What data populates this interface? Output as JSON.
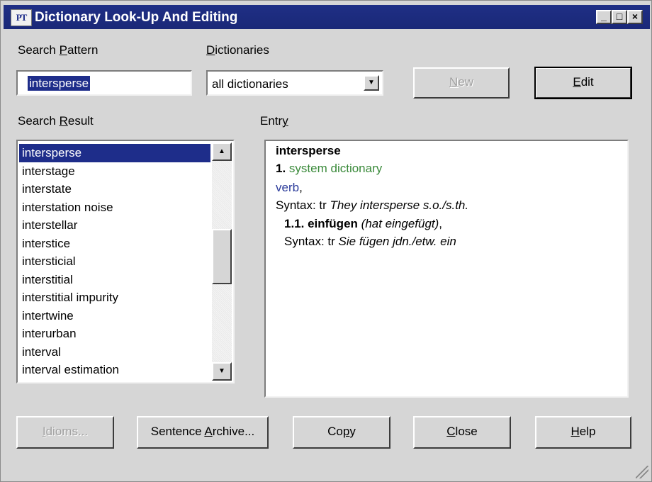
{
  "window": {
    "title": "Dictionary Look-Up And Editing",
    "icon_text": "PT",
    "controls": {
      "minimize": "_",
      "maximize": "□",
      "close": "×"
    }
  },
  "search": {
    "label_pre": "Search ",
    "label_key": "P",
    "label_post": "attern",
    "value": "intersperse"
  },
  "dictionaries": {
    "label_key": "D",
    "label_post": "ictionaries",
    "selected": "all dictionaries"
  },
  "buttons": {
    "new": {
      "key": "N",
      "rest": "ew"
    },
    "edit": {
      "key": "E",
      "rest": "dit"
    },
    "idioms": {
      "key": "I",
      "rest": "dioms..."
    },
    "sentence_archive": {
      "pre": "Sentence ",
      "key": "A",
      "rest": "rchive..."
    },
    "copy": {
      "pre": "Co",
      "key": "p",
      "rest": "y"
    },
    "close": {
      "key": "C",
      "rest": "lose"
    },
    "help": {
      "key": "H",
      "rest": "elp"
    }
  },
  "search_result": {
    "label_pre": "Search ",
    "label_key": "R",
    "label_post": "esult",
    "items": [
      "intersperse",
      "interstage",
      "interstate",
      "interstation noise",
      "interstellar",
      "interstice",
      "intersticial",
      "interstitial",
      "interstitial impurity",
      "intertwine",
      "interurban",
      "interval",
      "interval estimation"
    ],
    "selected_index": 0
  },
  "entry": {
    "label_pre": "Entr",
    "label_key": "y",
    "headword": "intersperse",
    "sense_num": "1.",
    "source": "system dictionary",
    "pos": "verb",
    "pos_suffix": ",",
    "syntax_label": "Syntax: tr ",
    "syntax_text": "They intersperse s.o./s.th.",
    "translation_num": "1.1. einfügen",
    "translation_note": "(hat eingefügt)",
    "translation_suffix": ",",
    "syntax2_label": "Syntax: tr ",
    "syntax2_text": "Sie fügen jdn./etw. ein"
  },
  "colors": {
    "titlebar": "#1f2f85",
    "selection": "#1e2d8a",
    "source_green": "#3a8a3a",
    "pos_blue": "#2a3a9a"
  }
}
